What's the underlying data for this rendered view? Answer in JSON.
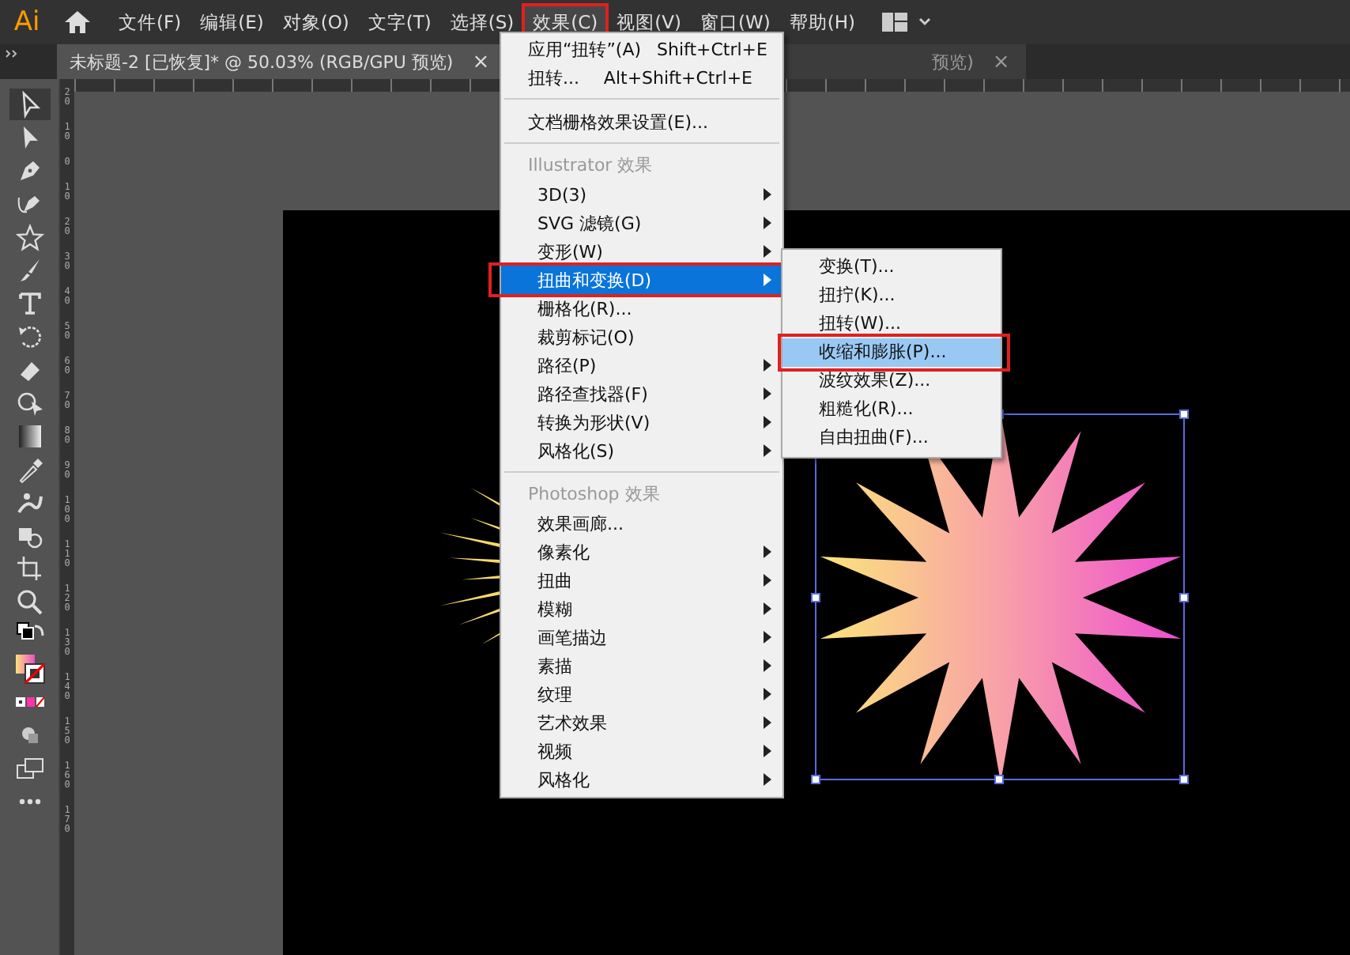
{
  "app": {
    "logo": "Ai"
  },
  "menubar": [
    {
      "label": "文件(F)",
      "selected": false
    },
    {
      "label": "编辑(E)",
      "selected": false
    },
    {
      "label": "对象(O)",
      "selected": false
    },
    {
      "label": "文字(T)",
      "selected": false
    },
    {
      "label": "选择(S)",
      "selected": false
    },
    {
      "label": "效果(C)",
      "selected": true,
      "marked": true
    },
    {
      "label": "视图(V)",
      "selected": false
    },
    {
      "label": "窗口(W)",
      "selected": false
    },
    {
      "label": "帮助(H)",
      "selected": false
    }
  ],
  "tabs": [
    {
      "label": "未标题-2 [已恢复]* @ 50.03% (RGB/GPU 预览)",
      "close": "×",
      "selected": true
    },
    {
      "label": "预览)",
      "close": "×",
      "selected": false
    }
  ],
  "tools": [
    {
      "kind": "selection",
      "selected": true
    },
    {
      "kind": "direct-selection",
      "selected": false
    },
    {
      "kind": "pen",
      "selected": false
    },
    {
      "kind": "curvature",
      "selected": false
    },
    {
      "kind": "star",
      "selected": false
    },
    {
      "kind": "brush",
      "selected": false
    },
    {
      "kind": "type",
      "selected": false
    },
    {
      "kind": "rotate",
      "selected": false
    },
    {
      "kind": "eraser",
      "selected": false
    },
    {
      "kind": "shape-builder",
      "selected": false
    },
    {
      "kind": "gradient",
      "selected": false
    },
    {
      "kind": "eyedropper",
      "selected": false
    },
    {
      "kind": "puppet",
      "selected": false
    },
    {
      "kind": "blend",
      "selected": false
    },
    {
      "kind": "artboard",
      "selected": false
    },
    {
      "kind": "zoom",
      "selected": false
    },
    {
      "kind": "swap",
      "selected": false
    },
    {
      "kind": "fill-stroke",
      "selected": false
    },
    {
      "kind": "color-modes",
      "selected": false
    },
    {
      "kind": "draw-mode",
      "selected": false
    },
    {
      "kind": "screen-mode",
      "selected": false
    },
    {
      "kind": "more",
      "selected": false
    }
  ],
  "vertical_ruler": [
    "20",
    "10",
    "0",
    "10",
    "20",
    "30",
    "40",
    "50",
    "60",
    "70",
    "80",
    "90",
    "100",
    "110",
    "120",
    "130",
    "140",
    "150",
    "160",
    "170"
  ],
  "effect_menu": [
    {
      "kind": "command",
      "label": "应用“扭转”(A)",
      "shortcut": "Shift+Ctrl+E"
    },
    {
      "kind": "command",
      "label": "扭转...",
      "shortcut": "Alt+Shift+Ctrl+E"
    },
    {
      "kind": "separator"
    },
    {
      "kind": "command",
      "label": "文档栅格效果设置(E)..."
    },
    {
      "kind": "separator"
    },
    {
      "kind": "header",
      "label": "Illustrator 效果"
    },
    {
      "kind": "item",
      "label": "3D(3)",
      "submenu": true,
      "selected": false
    },
    {
      "kind": "item",
      "label": "SVG 滤镜(G)",
      "submenu": true,
      "selected": false
    },
    {
      "kind": "item",
      "label": "变形(W)",
      "submenu": true,
      "selected": false
    },
    {
      "kind": "item",
      "label": "扭曲和变换(D)",
      "submenu": true,
      "selected": true,
      "marked": true
    },
    {
      "kind": "item",
      "label": "栅格化(R)...",
      "submenu": false,
      "selected": false
    },
    {
      "kind": "item",
      "label": "裁剪标记(O)",
      "submenu": false,
      "selected": false
    },
    {
      "kind": "item",
      "label": "路径(P)",
      "submenu": true,
      "selected": false
    },
    {
      "kind": "item",
      "label": "路径查找器(F)",
      "submenu": true,
      "selected": false
    },
    {
      "kind": "item",
      "label": "转换为形状(V)",
      "submenu": true,
      "selected": false
    },
    {
      "kind": "item",
      "label": "风格化(S)",
      "submenu": true,
      "selected": false
    },
    {
      "kind": "separator"
    },
    {
      "kind": "header",
      "label": "Photoshop 效果"
    },
    {
      "kind": "item",
      "label": "效果画廊...",
      "submenu": false,
      "selected": false
    },
    {
      "kind": "item",
      "label": "像素化",
      "submenu": true,
      "selected": false
    },
    {
      "kind": "item",
      "label": "扭曲",
      "submenu": true,
      "selected": false
    },
    {
      "kind": "item",
      "label": "模糊",
      "submenu": true,
      "selected": false
    },
    {
      "kind": "item",
      "label": "画笔描边",
      "submenu": true,
      "selected": false
    },
    {
      "kind": "item",
      "label": "素描",
      "submenu": true,
      "selected": false
    },
    {
      "kind": "item",
      "label": "纹理",
      "submenu": true,
      "selected": false
    },
    {
      "kind": "item",
      "label": "艺术效果",
      "submenu": true,
      "selected": false
    },
    {
      "kind": "item",
      "label": "视频",
      "submenu": true,
      "selected": false
    },
    {
      "kind": "item",
      "label": "风格化",
      "submenu": true,
      "selected": false
    }
  ],
  "distort_submenu": [
    {
      "label": "变换(T)...",
      "selected": false
    },
    {
      "label": "扭拧(K)...",
      "selected": false
    },
    {
      "label": "扭转(W)...",
      "selected": false
    },
    {
      "label": "收缩和膨胀(P)...",
      "selected": true,
      "marked": true
    },
    {
      "label": "波纹效果(Z)...",
      "selected": false
    },
    {
      "label": "粗糙化(R)...",
      "selected": false
    },
    {
      "label": "自由扭曲(F)...",
      "selected": false
    }
  ]
}
